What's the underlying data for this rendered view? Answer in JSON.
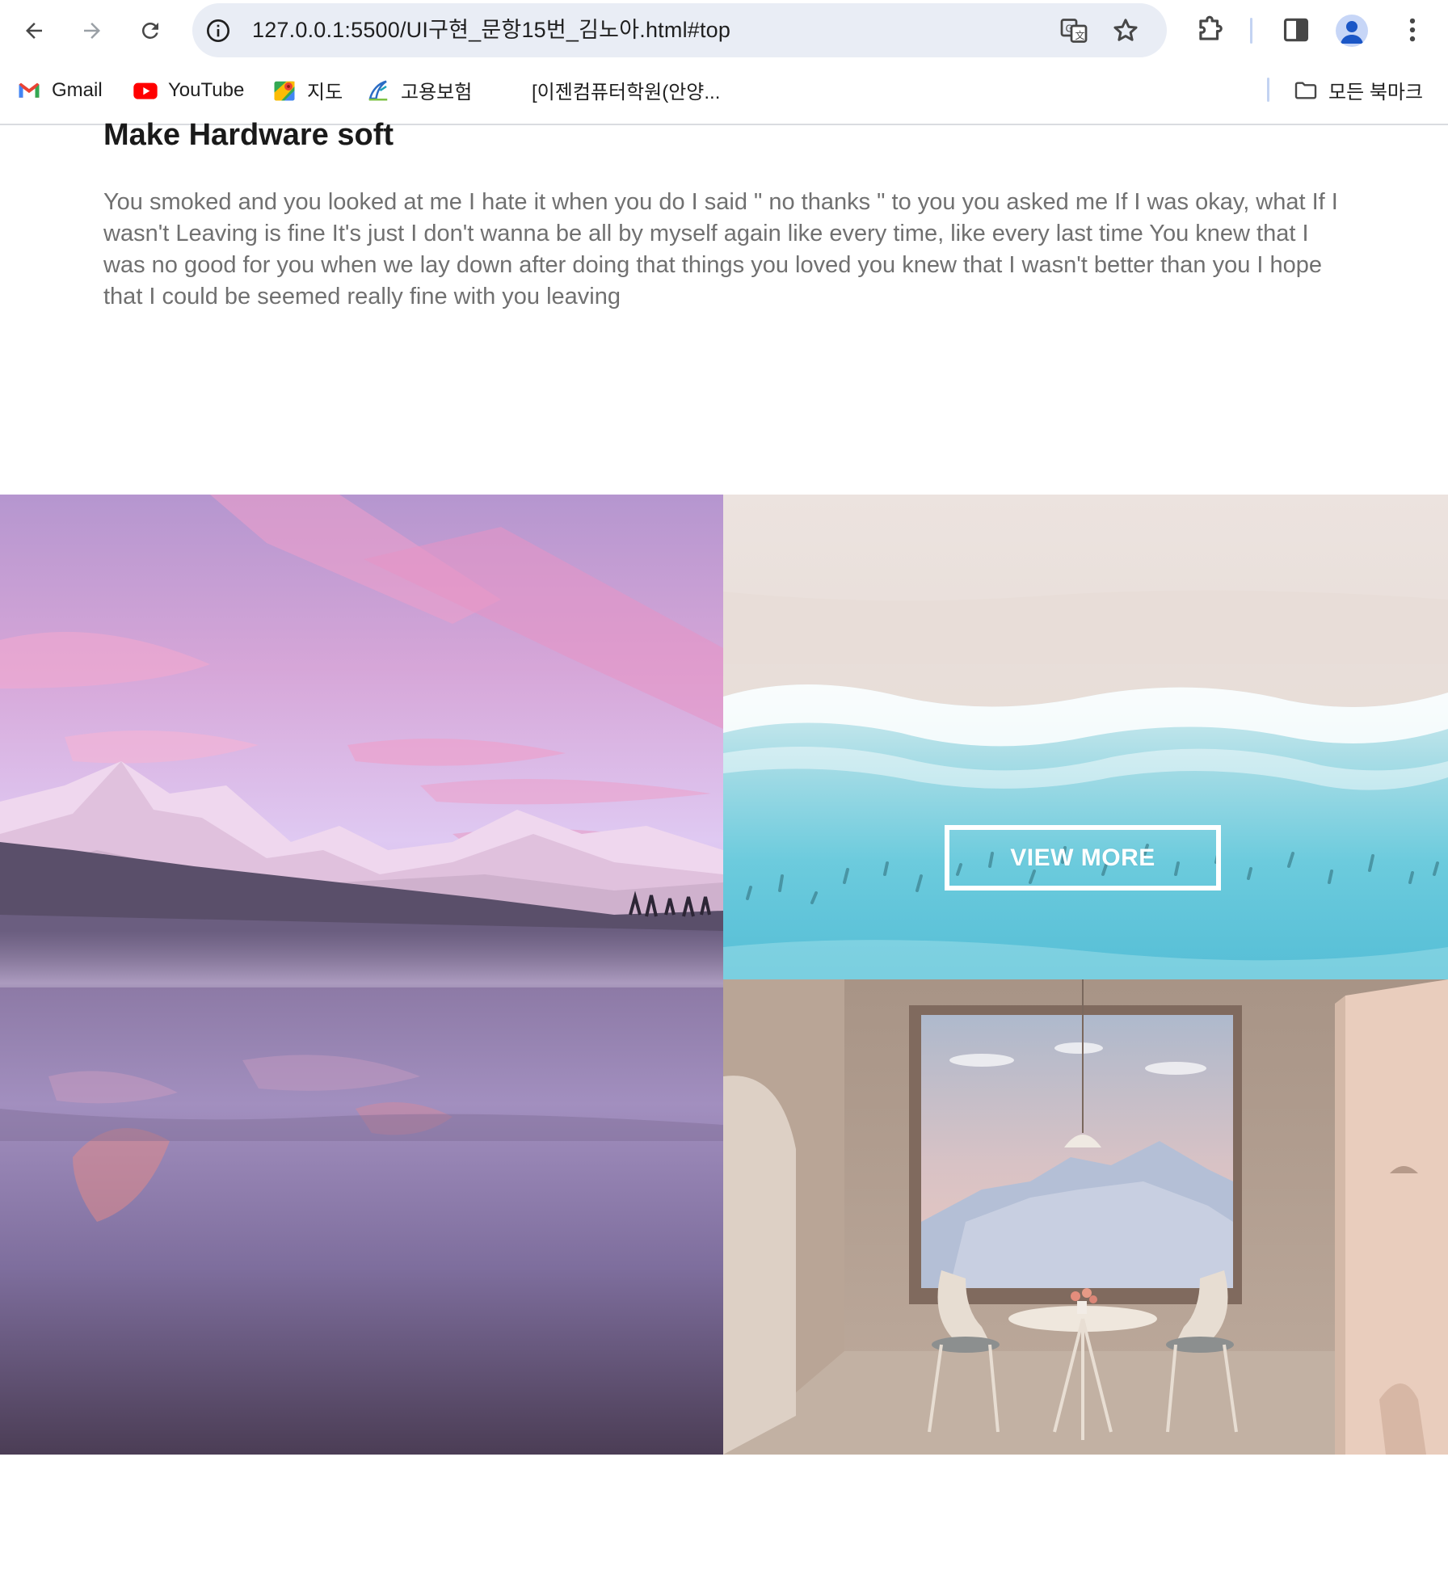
{
  "browser": {
    "url": "127.0.0.1:5500/UI구현_문항15번_김노아.html#top",
    "icons": {
      "back": "arrow-left-icon",
      "forward": "arrow-right-icon",
      "reload": "reload-icon",
      "site_info": "info-icon",
      "translate": "translate-icon",
      "bookmark": "star-icon",
      "extensions": "puzzle-icon",
      "side_panel": "side-panel-icon",
      "profile": "profile-icon",
      "menu": "more-vert-icon"
    },
    "bookmarks": [
      {
        "label": "Gmail",
        "icon": "gmail-icon"
      },
      {
        "label": "YouTube",
        "icon": "youtube-icon"
      },
      {
        "label": "지도",
        "icon": "maps-icon"
      },
      {
        "label": "고용보험",
        "icon": "employment-insurance-icon"
      },
      {
        "label": "[이젠컴퓨터학원(안양...",
        "icon": ""
      }
    ],
    "all_bookmarks": {
      "label": "모든 북마크",
      "icon": "folder-icon"
    }
  },
  "content": {
    "title": "Make Hardware soft",
    "paragraph": "You smoked and you looked at me I hate it when you do I said  \" no thanks \"  to you you asked me If I was okay, what If I wasn't Leaving is fine It's just I don't wanna be all by myself again like every time, like every last time You knew that I was no good for you when we lay down after doing that things you loved you knew that I wasn't better than you I hope that I could be seemed really fine with you leaving",
    "view_more_label": "VIEW MORE"
  },
  "colors": {
    "text_dark": "#1a1a1a",
    "text_gray": "#707070",
    "omnibox_bg": "#e9edf5",
    "accent_blue": "#1a56c6"
  }
}
